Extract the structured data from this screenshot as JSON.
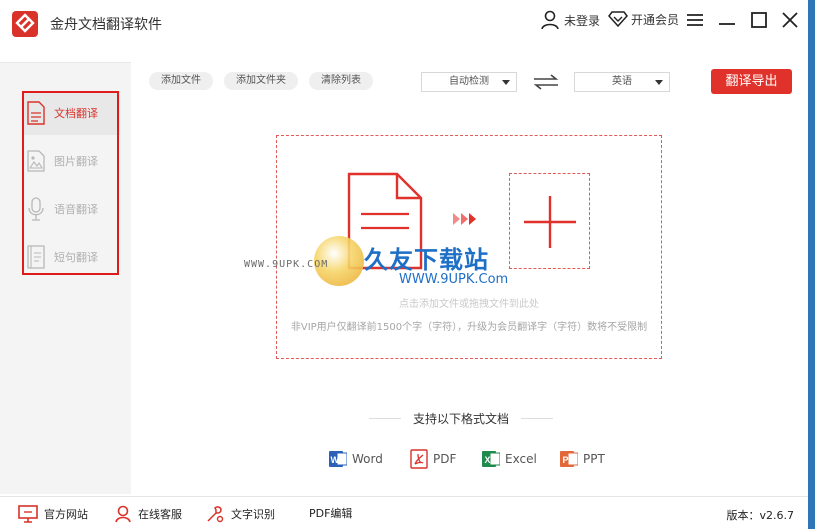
{
  "app": {
    "title": "金舟文档翻译软件"
  },
  "header": {
    "login_label": "未登录",
    "vip_label": "开通会员"
  },
  "sidebar": {
    "items": [
      {
        "label": "文档翻译",
        "icon": "document-icon",
        "active": true
      },
      {
        "label": "图片翻译",
        "icon": "image-icon",
        "active": false
      },
      {
        "label": "语音翻译",
        "icon": "microphone-icon",
        "active": false
      },
      {
        "label": "短句翻译",
        "icon": "text-icon",
        "active": false
      }
    ]
  },
  "toolbar": {
    "add_file": "添加文件",
    "add_folder": "添加文件夹",
    "clear_list": "清除列表",
    "source_lang": "自动检测",
    "target_lang": "英语",
    "export_label": "翻译导出"
  },
  "dropzone": {
    "hint": "点击添加文件或拖拽文件到此处",
    "vip_notice": "非VIP用户仅翻译前1500个字（字符），升级为会员翻译字（字符）数将不受限制"
  },
  "watermark": {
    "url": "WWW.9UPK.COM",
    "brand": "久友下载站",
    "url2": "WWW.9UPK.Com"
  },
  "formats": {
    "title": "支持以下格式文档",
    "items": [
      {
        "label": "Word",
        "color": "#2b5fb8"
      },
      {
        "label": "PDF",
        "color": "#d9322b"
      },
      {
        "label": "Excel",
        "color": "#1f8a4c"
      },
      {
        "label": "PPT",
        "color": "#e2683a"
      }
    ]
  },
  "footer": {
    "website": "官方网站",
    "service": "在线客服",
    "ocr": "文字识别",
    "pdf_edit": "PDF编辑",
    "version": "版本：v2.6.7"
  },
  "colors": {
    "accent": "#e0312b",
    "brand_blue": "#1e6fc6"
  }
}
